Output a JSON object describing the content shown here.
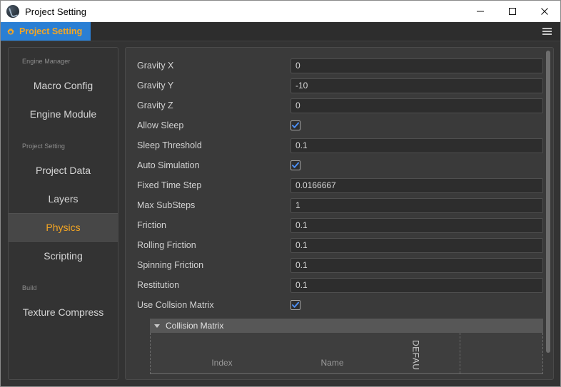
{
  "window": {
    "title": "Project Setting",
    "app_icon": "app-logo-icon",
    "minimize_label": "Minimize",
    "maximize_label": "Maximize",
    "close_label": "Close"
  },
  "tabbar": {
    "tabs": [
      {
        "label": "Project Setting",
        "icon": "gear-icon",
        "active": true
      }
    ],
    "menu_icon": "hamburger-menu-icon"
  },
  "sidebar": {
    "groups": [
      {
        "label": "Engine Manager",
        "items": [
          {
            "label": "Macro Config",
            "active": false
          },
          {
            "label": "Engine Module",
            "active": false
          }
        ]
      },
      {
        "label": "Project Setting",
        "items": [
          {
            "label": "Project Data",
            "active": false
          },
          {
            "label": "Layers",
            "active": false
          },
          {
            "label": "Physics",
            "active": true
          },
          {
            "label": "Scripting",
            "active": false
          }
        ]
      },
      {
        "label": "Build",
        "items": [
          {
            "label": "Texture Compress",
            "active": false
          }
        ]
      }
    ]
  },
  "content": {
    "fields": [
      {
        "label": "Gravity X",
        "type": "text",
        "value": "0"
      },
      {
        "label": "Gravity Y",
        "type": "text",
        "value": "-10"
      },
      {
        "label": "Gravity Z",
        "type": "text",
        "value": "0"
      },
      {
        "label": "Allow Sleep",
        "type": "checkbox",
        "checked": true
      },
      {
        "label": "Sleep Threshold",
        "type": "text",
        "value": "0.1"
      },
      {
        "label": "Auto Simulation",
        "type": "checkbox",
        "checked": true
      },
      {
        "label": "Fixed Time Step",
        "type": "text",
        "value": "0.0166667"
      },
      {
        "label": "Max SubSteps",
        "type": "text",
        "value": "1"
      },
      {
        "label": "Friction",
        "type": "text",
        "value": "0.1"
      },
      {
        "label": "Rolling Friction",
        "type": "text",
        "value": "0.1"
      },
      {
        "label": "Spinning Friction",
        "type": "text",
        "value": "0.1"
      },
      {
        "label": "Restitution",
        "type": "text",
        "value": "0.1"
      },
      {
        "label": "Use Collsion Matrix",
        "type": "checkbox",
        "checked": true
      }
    ],
    "collision_matrix": {
      "title": "Collision Matrix",
      "expanded": true,
      "columns": [
        {
          "header": "Index",
          "orientation": "horizontal"
        },
        {
          "header": "Name",
          "orientation": "horizontal"
        },
        {
          "header": "DEFAU",
          "orientation": "vertical"
        }
      ],
      "rows": []
    }
  },
  "colors": {
    "accent_orange": "#f5a623",
    "tab_blue": "#2a7fd4",
    "checkbox_blue": "#4a8cf0",
    "panel_bg": "#3a3a3a",
    "window_bg": "#333333"
  }
}
